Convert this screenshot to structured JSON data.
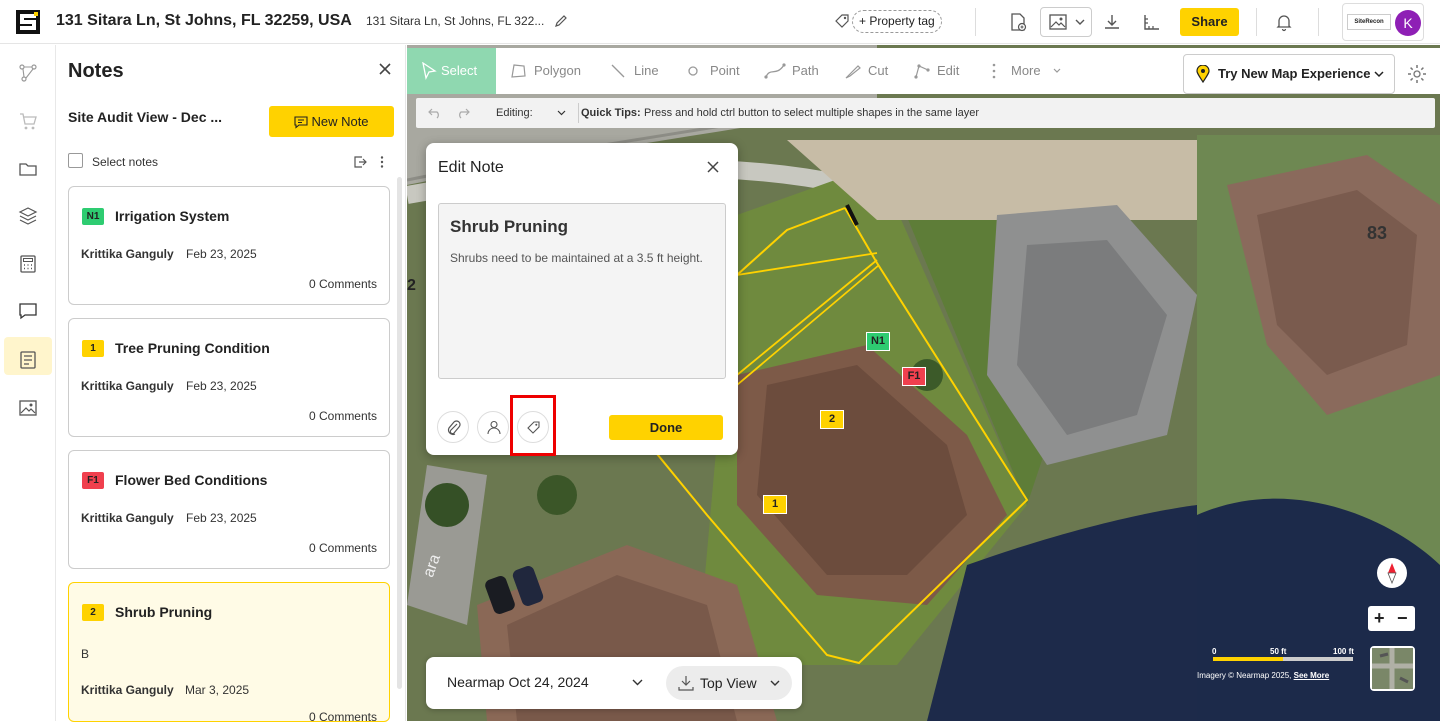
{
  "header": {
    "address": "131 Sitara Ln, St Johns, FL 32259, USA",
    "address_short": "131 Sitara Ln, St Johns, FL 322...",
    "property_tag": "+ Property tag",
    "share": "Share",
    "account_logo": "SiteRecon",
    "avatar_initial": "K"
  },
  "notes_panel": {
    "title": "Notes",
    "view_name": "Site Audit View - Dec ...",
    "new_note": "New Note",
    "select_notes": "Select notes",
    "cards": [
      {
        "badge": "N1",
        "badge_color": "#2ecc71",
        "badge_text_color": "#111",
        "title": "Irrigation System",
        "author": "Krittika Ganguly",
        "date": "Feb 23, 2025",
        "comments": "0 Comments"
      },
      {
        "badge": "1",
        "badge_color": "#ffd200",
        "badge_text_color": "#222",
        "title": "Tree Pruning Condition",
        "author": "Krittika Ganguly",
        "date": "Feb 23, 2025",
        "comments": "0 Comments"
      },
      {
        "badge": "F1",
        "badge_color": "#f0404e",
        "badge_text_color": "#222",
        "title": "Flower Bed Conditions",
        "author": "Krittika Ganguly",
        "date": "Feb 23, 2025",
        "comments": "0 Comments"
      },
      {
        "badge": "2",
        "badge_color": "#ffd200",
        "badge_text_color": "#222",
        "title": "Shrub Pruning",
        "body": "B",
        "author": "Krittika Ganguly",
        "date": "Mar 3, 2025",
        "comments": "0 Comments"
      }
    ]
  },
  "toolbar": {
    "tools": [
      "Select",
      "Polygon",
      "Line",
      "Point",
      "Path",
      "Cut",
      "Edit",
      "More"
    ],
    "try_map": "Try New Map Experience",
    "editing_label": "Editing:",
    "quick_tips_label": "Quick Tips:",
    "quick_tips_text": "Press and hold ctrl button to select multiple shapes in the same layer"
  },
  "edit_note": {
    "title": "Edit Note",
    "note_title": "Shrub Pruning",
    "note_body": "Shrubs need to be maintained at a 3.5 ft height.",
    "done": "Done"
  },
  "map": {
    "markers": [
      "N1",
      "F1",
      "2",
      "1"
    ],
    "house_number": "83",
    "side_label": "2",
    "street_fragment": "ara",
    "imagery_date": "Nearmap Oct 24, 2024",
    "view_mode": "Top View",
    "scale_labels": [
      "0",
      "50 ft",
      "100 ft"
    ],
    "attribution": "Imagery © Nearmap 2025, ",
    "see_more": "See More",
    "colors": {
      "boundary": "#ffd200",
      "accent": "#ffd200",
      "select_active": "#8fd8b0"
    }
  }
}
